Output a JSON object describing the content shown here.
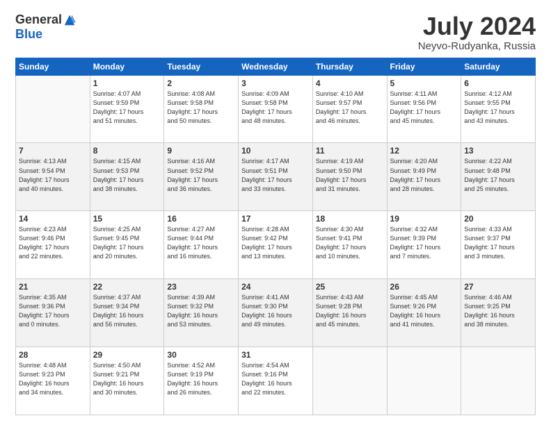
{
  "header": {
    "logo_general": "General",
    "logo_blue": "Blue",
    "month_title": "July 2024",
    "location": "Neyvo-Rudyanka, Russia"
  },
  "days_of_week": [
    "Sunday",
    "Monday",
    "Tuesday",
    "Wednesday",
    "Thursday",
    "Friday",
    "Saturday"
  ],
  "weeks": [
    {
      "shaded": false,
      "days": [
        {
          "num": "",
          "info": ""
        },
        {
          "num": "1",
          "info": "Sunrise: 4:07 AM\nSunset: 9:59 PM\nDaylight: 17 hours\nand 51 minutes."
        },
        {
          "num": "2",
          "info": "Sunrise: 4:08 AM\nSunset: 9:58 PM\nDaylight: 17 hours\nand 50 minutes."
        },
        {
          "num": "3",
          "info": "Sunrise: 4:09 AM\nSunset: 9:58 PM\nDaylight: 17 hours\nand 48 minutes."
        },
        {
          "num": "4",
          "info": "Sunrise: 4:10 AM\nSunset: 9:57 PM\nDaylight: 17 hours\nand 46 minutes."
        },
        {
          "num": "5",
          "info": "Sunrise: 4:11 AM\nSunset: 9:56 PM\nDaylight: 17 hours\nand 45 minutes."
        },
        {
          "num": "6",
          "info": "Sunrise: 4:12 AM\nSunset: 9:55 PM\nDaylight: 17 hours\nand 43 minutes."
        }
      ]
    },
    {
      "shaded": true,
      "days": [
        {
          "num": "7",
          "info": "Sunrise: 4:13 AM\nSunset: 9:54 PM\nDaylight: 17 hours\nand 40 minutes."
        },
        {
          "num": "8",
          "info": "Sunrise: 4:15 AM\nSunset: 9:53 PM\nDaylight: 17 hours\nand 38 minutes."
        },
        {
          "num": "9",
          "info": "Sunrise: 4:16 AM\nSunset: 9:52 PM\nDaylight: 17 hours\nand 36 minutes."
        },
        {
          "num": "10",
          "info": "Sunrise: 4:17 AM\nSunset: 9:51 PM\nDaylight: 17 hours\nand 33 minutes."
        },
        {
          "num": "11",
          "info": "Sunrise: 4:19 AM\nSunset: 9:50 PM\nDaylight: 17 hours\nand 31 minutes."
        },
        {
          "num": "12",
          "info": "Sunrise: 4:20 AM\nSunset: 9:49 PM\nDaylight: 17 hours\nand 28 minutes."
        },
        {
          "num": "13",
          "info": "Sunrise: 4:22 AM\nSunset: 9:48 PM\nDaylight: 17 hours\nand 25 minutes."
        }
      ]
    },
    {
      "shaded": false,
      "days": [
        {
          "num": "14",
          "info": "Sunrise: 4:23 AM\nSunset: 9:46 PM\nDaylight: 17 hours\nand 22 minutes."
        },
        {
          "num": "15",
          "info": "Sunrise: 4:25 AM\nSunset: 9:45 PM\nDaylight: 17 hours\nand 20 minutes."
        },
        {
          "num": "16",
          "info": "Sunrise: 4:27 AM\nSunset: 9:44 PM\nDaylight: 17 hours\nand 16 minutes."
        },
        {
          "num": "17",
          "info": "Sunrise: 4:28 AM\nSunset: 9:42 PM\nDaylight: 17 hours\nand 13 minutes."
        },
        {
          "num": "18",
          "info": "Sunrise: 4:30 AM\nSunset: 9:41 PM\nDaylight: 17 hours\nand 10 minutes."
        },
        {
          "num": "19",
          "info": "Sunrise: 4:32 AM\nSunset: 9:39 PM\nDaylight: 17 hours\nand 7 minutes."
        },
        {
          "num": "20",
          "info": "Sunrise: 4:33 AM\nSunset: 9:37 PM\nDaylight: 17 hours\nand 3 minutes."
        }
      ]
    },
    {
      "shaded": true,
      "days": [
        {
          "num": "21",
          "info": "Sunrise: 4:35 AM\nSunset: 9:36 PM\nDaylight: 17 hours\nand 0 minutes."
        },
        {
          "num": "22",
          "info": "Sunrise: 4:37 AM\nSunset: 9:34 PM\nDaylight: 16 hours\nand 56 minutes."
        },
        {
          "num": "23",
          "info": "Sunrise: 4:39 AM\nSunset: 9:32 PM\nDaylight: 16 hours\nand 53 minutes."
        },
        {
          "num": "24",
          "info": "Sunrise: 4:41 AM\nSunset: 9:30 PM\nDaylight: 16 hours\nand 49 minutes."
        },
        {
          "num": "25",
          "info": "Sunrise: 4:43 AM\nSunset: 9:28 PM\nDaylight: 16 hours\nand 45 minutes."
        },
        {
          "num": "26",
          "info": "Sunrise: 4:45 AM\nSunset: 9:26 PM\nDaylight: 16 hours\nand 41 minutes."
        },
        {
          "num": "27",
          "info": "Sunrise: 4:46 AM\nSunset: 9:25 PM\nDaylight: 16 hours\nand 38 minutes."
        }
      ]
    },
    {
      "shaded": false,
      "days": [
        {
          "num": "28",
          "info": "Sunrise: 4:48 AM\nSunset: 9:23 PM\nDaylight: 16 hours\nand 34 minutes."
        },
        {
          "num": "29",
          "info": "Sunrise: 4:50 AM\nSunset: 9:21 PM\nDaylight: 16 hours\nand 30 minutes."
        },
        {
          "num": "30",
          "info": "Sunrise: 4:52 AM\nSunset: 9:19 PM\nDaylight: 16 hours\nand 26 minutes."
        },
        {
          "num": "31",
          "info": "Sunrise: 4:54 AM\nSunset: 9:16 PM\nDaylight: 16 hours\nand 22 minutes."
        },
        {
          "num": "",
          "info": ""
        },
        {
          "num": "",
          "info": ""
        },
        {
          "num": "",
          "info": ""
        }
      ]
    }
  ]
}
